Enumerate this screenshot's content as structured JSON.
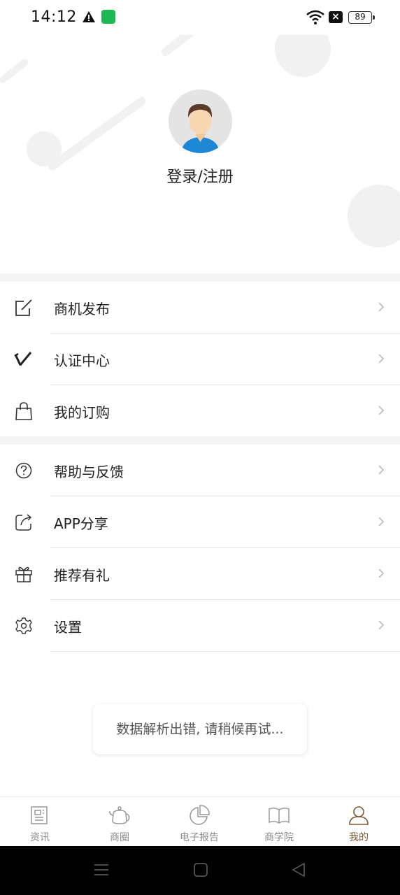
{
  "status_bar": {
    "time": "14:12",
    "battery": "89"
  },
  "profile": {
    "login_label": "登录/注册"
  },
  "menu": {
    "group1": [
      {
        "label": "商机发布",
        "icon": "edit-icon"
      },
      {
        "label": "认证中心",
        "icon": "verify-icon"
      },
      {
        "label": "我的订购",
        "icon": "shopping-bag-icon"
      }
    ],
    "group2": [
      {
        "label": "帮助与反馈",
        "icon": "help-icon"
      },
      {
        "label": "APP分享",
        "icon": "share-icon"
      },
      {
        "label": "推荐有礼",
        "icon": "gift-icon"
      },
      {
        "label": "设置",
        "icon": "gear-icon"
      }
    ]
  },
  "toast": {
    "message": "数据解析出错, 请稍候再试..."
  },
  "tabs": [
    {
      "label": "资讯",
      "icon": "news-icon"
    },
    {
      "label": "商圈",
      "icon": "teapot-icon"
    },
    {
      "label": "电子报告",
      "icon": "pie-chart-icon"
    },
    {
      "label": "商学院",
      "icon": "book-icon"
    },
    {
      "label": "我的",
      "icon": "user-icon",
      "active": true
    }
  ],
  "colors": {
    "accent": "#7a5a33",
    "avatar_shirt": "#1e88d6",
    "divider": "#e6e6e6"
  }
}
